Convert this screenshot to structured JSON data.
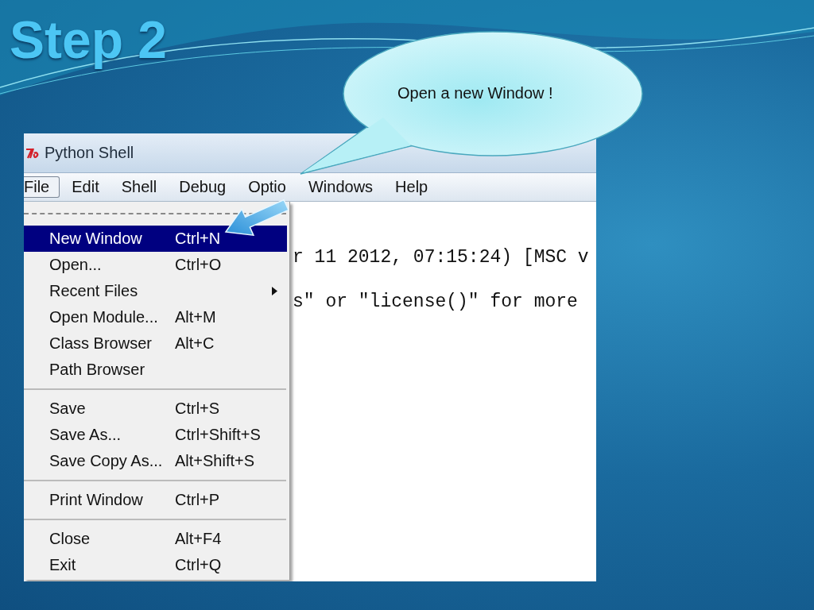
{
  "slide": {
    "title": "Step 2"
  },
  "callout": {
    "text": "Open a new Window !"
  },
  "window": {
    "title": "Python Shell",
    "menu_bar": [
      {
        "label": "File",
        "selected": true
      },
      {
        "label": "Edit",
        "selected": false
      },
      {
        "label": "Shell",
        "selected": false
      },
      {
        "label": "Debug",
        "selected": false
      },
      {
        "label": "Optio",
        "selected": false
      },
      {
        "label": "Windows",
        "selected": false
      },
      {
        "label": "Help",
        "selected": false
      }
    ],
    "console_lines": [
      "r 11 2012, 07:15:24) [MSC v",
      "s\" or \"license()\" for more"
    ],
    "file_menu": [
      {
        "kind": "tearoff"
      },
      {
        "kind": "item",
        "label": "New Window",
        "shortcut": "Ctrl+N",
        "selected": true,
        "submenu": false
      },
      {
        "kind": "item",
        "label": "Open...",
        "shortcut": "Ctrl+O",
        "selected": false,
        "submenu": false
      },
      {
        "kind": "item",
        "label": "Recent Files",
        "selected": false,
        "submenu": true
      },
      {
        "kind": "item",
        "label": "Open Module...",
        "shortcut": "Alt+M",
        "selected": false,
        "submenu": false
      },
      {
        "kind": "item",
        "label": "Class Browser",
        "shortcut": "Alt+C",
        "selected": false,
        "submenu": false
      },
      {
        "kind": "item",
        "label": "Path Browser",
        "selected": false,
        "submenu": false
      },
      {
        "kind": "separator"
      },
      {
        "kind": "item",
        "label": "Save",
        "shortcut": "Ctrl+S",
        "selected": false,
        "submenu": false
      },
      {
        "kind": "item",
        "label": "Save As...",
        "shortcut": "Ctrl+Shift+S",
        "selected": false,
        "submenu": false
      },
      {
        "kind": "item",
        "label": "Save Copy As...",
        "shortcut": "Alt+Shift+S",
        "selected": false,
        "submenu": false
      },
      {
        "kind": "separator"
      },
      {
        "kind": "item",
        "label": "Print Window",
        "shortcut": "Ctrl+P",
        "selected": false,
        "submenu": false
      },
      {
        "kind": "separator"
      },
      {
        "kind": "item",
        "label": "Close",
        "shortcut": "Alt+F4",
        "selected": false,
        "submenu": false
      },
      {
        "kind": "item",
        "label": "Exit",
        "shortcut": "Ctrl+Q",
        "selected": false,
        "submenu": false
      }
    ]
  }
}
